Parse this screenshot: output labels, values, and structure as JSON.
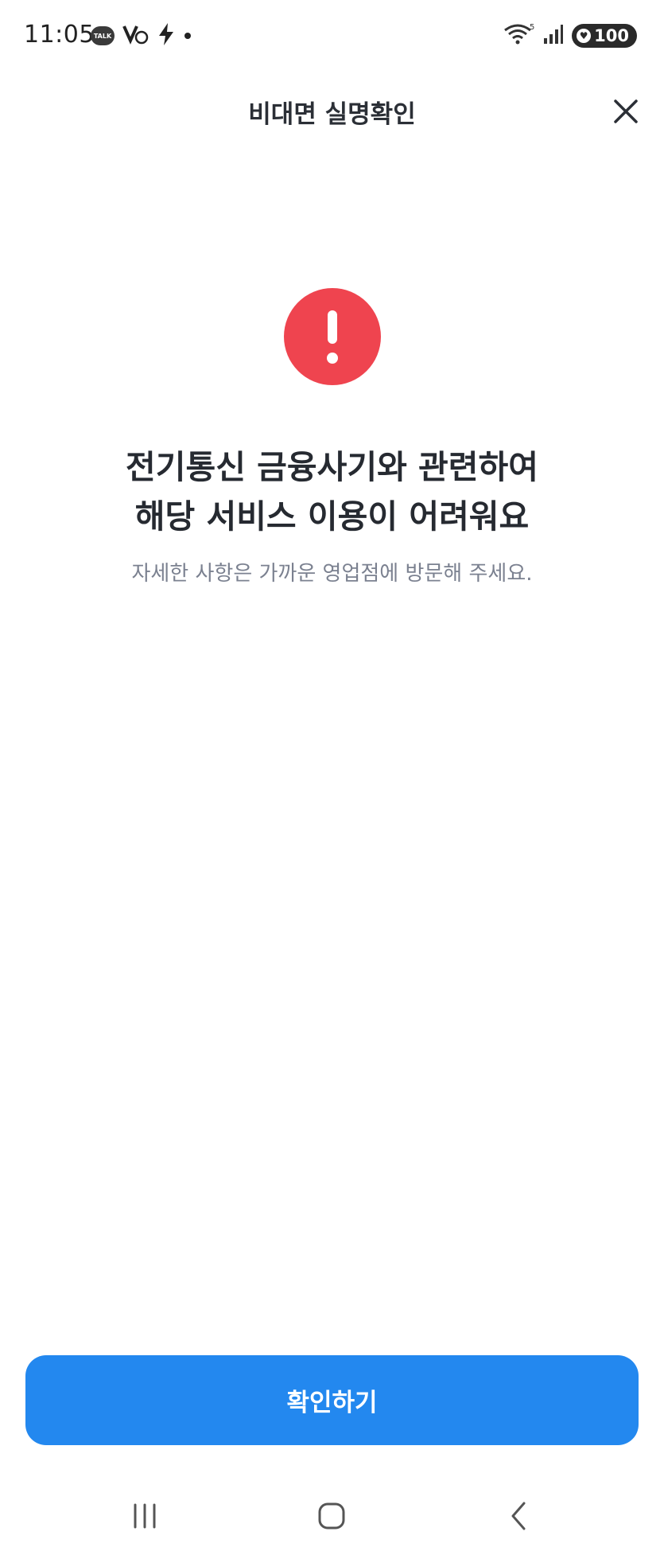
{
  "status_bar": {
    "time": "11:05",
    "talk_badge": "TALK",
    "signal_label": "5",
    "battery_level": "100"
  },
  "header": {
    "title": "비대면 실명확인"
  },
  "main": {
    "title_line1": "전기통신 금융사기와 관련하여",
    "title_line2": "해당 서비스 이용이 어려워요",
    "subtitle": "자세한 사항은 가까운 영업점에 방문해 주세요."
  },
  "actions": {
    "confirm_label": "확인하기"
  },
  "colors": {
    "alert_red": "#ef444f",
    "primary_blue": "#2388ef"
  }
}
